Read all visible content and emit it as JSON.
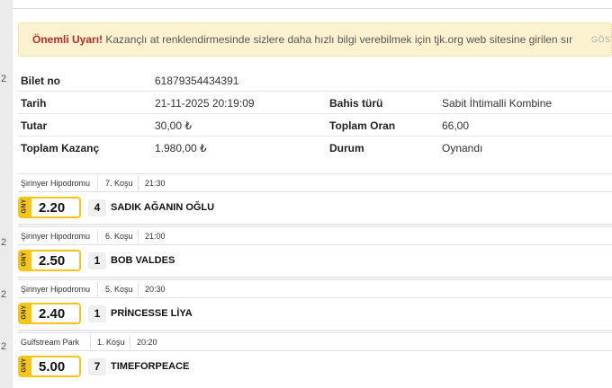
{
  "alert": {
    "strong": "Önemli Uyarı!",
    "text": " Kazançlı at renklendirmesinde sizlere daha hızlı bilgi verebilmek için tjk.org web sitesine girilen sırala...",
    "show_label": "GÖSTER"
  },
  "ticket": {
    "bilet_no_label": "Bilet no",
    "bilet_no": "61879354434391",
    "tarih_label": "Tarih",
    "tarih": "21-11-2025 20:19:09",
    "bahis_turu_label": "Bahis türü",
    "bahis_turu": "Sabit İhtimalli Kombine",
    "tutar_label": "Tutar",
    "tutar": "30,00 ₺",
    "toplam_oran_label": "Toplam Oran",
    "toplam_oran": "66,00",
    "toplam_kazanc_label": "Toplam Kazanç",
    "toplam_kazanc": "1.980,00 ₺",
    "durum_label": "Durum",
    "durum": "Oynandı"
  },
  "races": [
    {
      "track": "Şirinyer Hipodromu",
      "kosu": "7. Koşu",
      "time": "21:30",
      "bet_type": "GNY",
      "odds": "2.20",
      "horse_no": "4",
      "horse": "SADIK AĞANIN OĞLU"
    },
    {
      "track": "Şirinyer Hipodromu",
      "kosu": "6. Koşu",
      "time": "21:00",
      "bet_type": "GNY",
      "odds": "2.50",
      "horse_no": "1",
      "horse": "BOB VALDES"
    },
    {
      "track": "Şirinyer Hipodromu",
      "kosu": "5. Koşu",
      "time": "20:30",
      "bet_type": "GNY",
      "odds": "2.40",
      "horse_no": "1",
      "horse": "PRİNCESSE LİYA"
    },
    {
      "track": "Gulfstream Park",
      "kosu": "1. Koşu",
      "time": "20:20",
      "bet_type": "GNY",
      "odds": "5.00",
      "horse_no": "7",
      "horse": "TIMEFORPEACE"
    }
  ],
  "strip": [
    "2",
    "2",
    "2",
    "2"
  ],
  "colors": {
    "accent": "#f5c518",
    "alert_bg": "#fdf2d0",
    "alert_strong": "#c0282d"
  }
}
